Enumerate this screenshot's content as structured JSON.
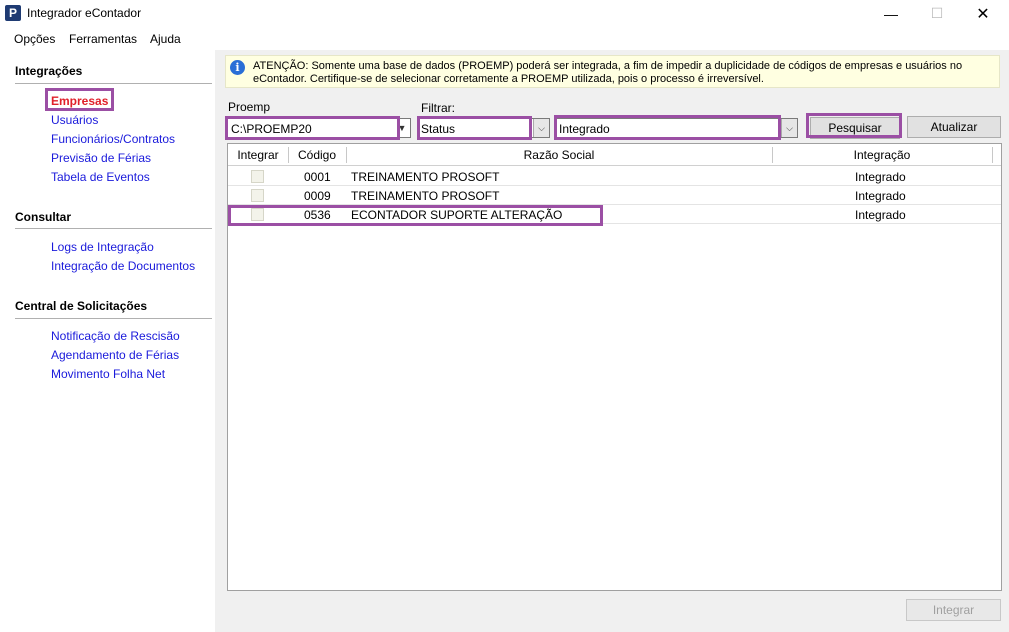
{
  "window": {
    "title": "Integrador eContador",
    "minimize": "—",
    "maximize": "☐",
    "close": "✕"
  },
  "menu": [
    "Opções",
    "Ferramentas",
    "Ajuda"
  ],
  "sidebar": {
    "sections": [
      {
        "title": "Integrações",
        "items": [
          "Empresas",
          "Usuários",
          "Funcionários/Contratos",
          "Previsão de Férias",
          "Tabela de Eventos"
        ]
      },
      {
        "title": "Consultar",
        "items": [
          "Logs de Integração",
          "Integração de Documentos"
        ]
      },
      {
        "title": "Central de Solicitações",
        "items": [
          "Notificação de Rescisão",
          "Agendamento de Férias",
          "Movimento Folha Net"
        ]
      }
    ],
    "active_item": "Empresas"
  },
  "notice": {
    "text": "ATENÇÃO: Somente uma base de dados (PROEMP) poderá ser integrada, a fim de impedir a duplicidade de códigos de empresas e usuários no eContador. Certifique-se de selecionar corretamente a PROEMP utilizada, pois o processo é irreversível."
  },
  "filters": {
    "proemp_label": "Proemp",
    "proemp_value": "C:\\PROEMP20",
    "filtrar_label": "Filtrar:",
    "filter_field": "Status",
    "filter_value": "Integrado",
    "search_button": "Pesquisar",
    "refresh_button": "Atualizar"
  },
  "table": {
    "columns": [
      "Integrar",
      "Código",
      "Razão Social",
      "Integração"
    ],
    "rows": [
      {
        "codigo": "0001",
        "razao": "TREINAMENTO PROSOFT",
        "integracao": "Integrado"
      },
      {
        "codigo": "0009",
        "razao": "TREINAMENTO PROSOFT",
        "integracao": "Integrado"
      },
      {
        "codigo": "0536",
        "razao": "ECONTADOR SUPORTE ALTERAÇÃO",
        "integracao": "Integrado"
      }
    ]
  },
  "footer": {
    "integrar_button": "Integrar"
  },
  "colors": {
    "highlight": "#9b4fa4",
    "link": "#1a1adb",
    "active": "#e0202a",
    "notice_bg": "#ffffe1"
  }
}
